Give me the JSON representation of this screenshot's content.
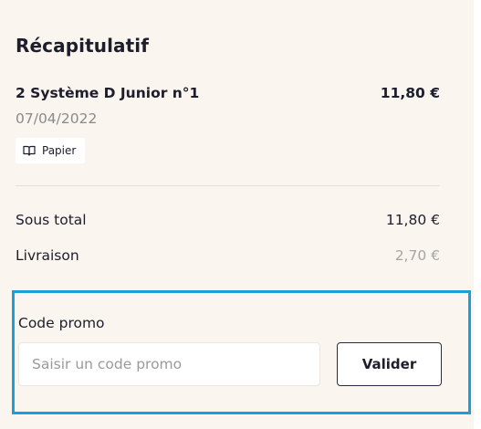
{
  "summary": {
    "title": "Récapitulatif",
    "product": {
      "name": "2 Système D Junior n°1",
      "price": "11,80 €",
      "date": "07/04/2022",
      "format": {
        "label": "Papier",
        "icon": "book-icon"
      }
    },
    "subtotal": {
      "label": "Sous total",
      "value": "11,80 €"
    },
    "shipping": {
      "label": "Livraison",
      "value": "2,70 €"
    }
  },
  "promo": {
    "label": "Code promo",
    "placeholder": "Saisir un code promo",
    "value": "",
    "button_label": "Valider",
    "highlight_color": "#1aa0d6"
  },
  "colors": {
    "background": "#faf5ef",
    "text": "#1d1d2c",
    "muted": "#8a8a8a"
  }
}
